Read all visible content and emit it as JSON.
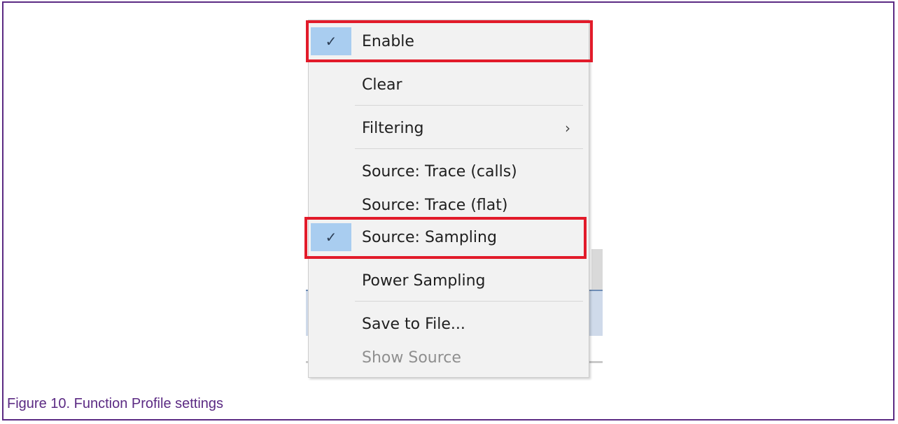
{
  "menu": {
    "items": [
      {
        "label": "Enable",
        "checked": true,
        "disabled": false,
        "submenu": false
      },
      {
        "label": "Clear",
        "checked": false,
        "disabled": false,
        "submenu": false
      },
      {
        "label": "Filtering",
        "checked": false,
        "disabled": false,
        "submenu": true
      },
      {
        "label": "Source: Trace (calls)",
        "checked": false,
        "disabled": false,
        "submenu": false
      },
      {
        "label": "Source: Trace (flat)",
        "checked": false,
        "disabled": false,
        "submenu": false
      },
      {
        "label": "Source: Sampling",
        "checked": true,
        "disabled": false,
        "submenu": false
      },
      {
        "label": "Power Sampling",
        "checked": false,
        "disabled": false,
        "submenu": false
      },
      {
        "label": "Save to File...",
        "checked": false,
        "disabled": false,
        "submenu": false
      },
      {
        "label": "Show Source",
        "checked": false,
        "disabled": true,
        "submenu": false
      }
    ],
    "check_glyph": "✓",
    "submenu_glyph": "›"
  },
  "highlight_color": "#e21b2a",
  "check_highlight_color": "#a9cdf0",
  "caption": "Figure 10.  Function Profile settings"
}
